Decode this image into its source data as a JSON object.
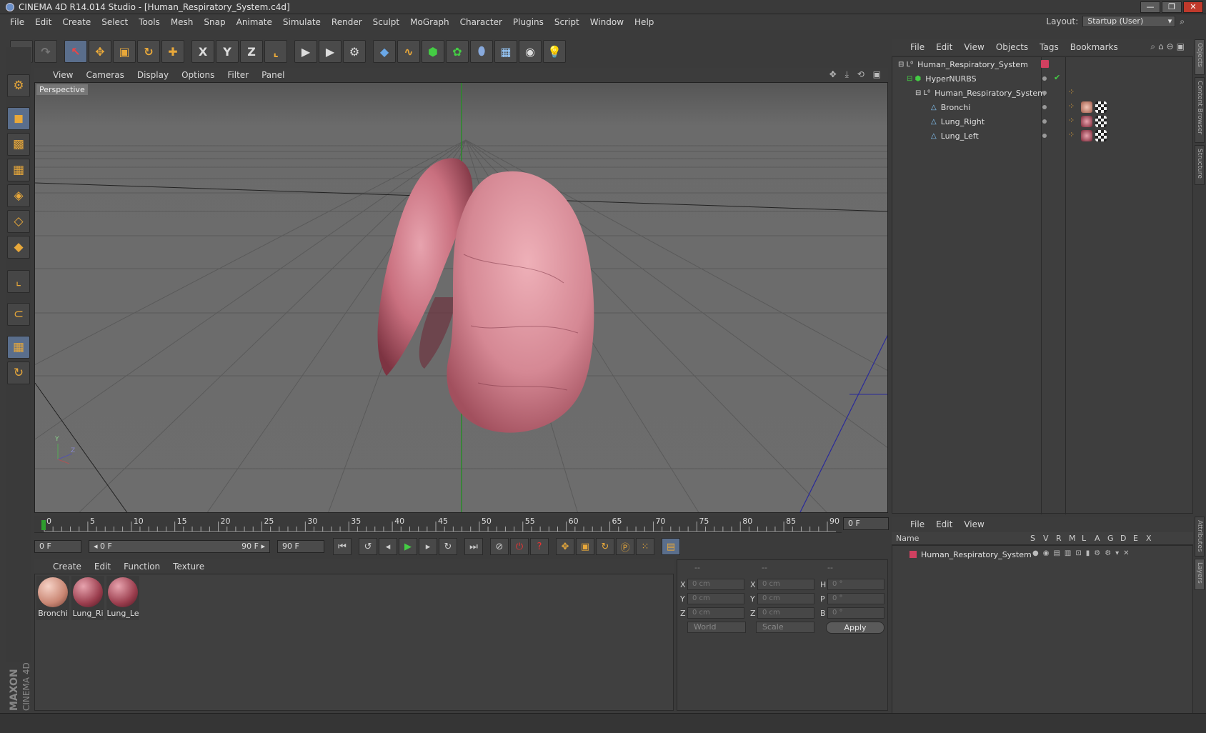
{
  "window": {
    "title": "CINEMA 4D R14.014 Studio - [Human_Respiratory_System.c4d]",
    "buttons": [
      "—",
      "❐",
      "✕"
    ]
  },
  "menubar": {
    "items": [
      "File",
      "Edit",
      "Create",
      "Select",
      "Tools",
      "Mesh",
      "Snap",
      "Animate",
      "Simulate",
      "Render",
      "Sculpt",
      "MoGraph",
      "Character",
      "Plugins",
      "Script",
      "Window",
      "Help"
    ],
    "layout_label": "Layout:",
    "layout_value": "Startup (User)"
  },
  "toolbar": {
    "axis_x": "X",
    "axis_y": "Y",
    "axis_z": "Z"
  },
  "viewport": {
    "menu": [
      "View",
      "Cameras",
      "Display",
      "Options",
      "Filter",
      "Panel"
    ],
    "label": "Perspective",
    "icons": "✥ ⤓ ⟲ ▣",
    "axis_y": "Y",
    "axis_z": "Z"
  },
  "timeline": {
    "ticks": [
      "0",
      "5",
      "10",
      "15",
      "20",
      "25",
      "30",
      "35",
      "40",
      "45",
      "50",
      "55",
      "60",
      "65",
      "70",
      "75",
      "80",
      "85",
      "90"
    ],
    "current_frame": "0 F"
  },
  "transport": {
    "start": "0 F",
    "range_start": "◂ 0 F",
    "range_end": "90 F ▸",
    "end": "90 F"
  },
  "materials": {
    "menu": [
      "Create",
      "Edit",
      "Function",
      "Texture"
    ],
    "items": [
      {
        "label": "Bronchi"
      },
      {
        "label": "Lung_Ri"
      },
      {
        "label": "Lung_Le"
      }
    ]
  },
  "coords": {
    "headers": [
      "--",
      "--",
      "--"
    ],
    "rows": [
      {
        "a": "X",
        "av": "0 cm",
        "b": "X",
        "bv": "0 cm",
        "c": "H",
        "cv": "0 °"
      },
      {
        "a": "Y",
        "av": "0 cm",
        "b": "Y",
        "bv": "0 cm",
        "c": "P",
        "cv": "0 °"
      },
      {
        "a": "Z",
        "av": "0 cm",
        "b": "Z",
        "bv": "0 cm",
        "c": "B",
        "cv": "0 °"
      }
    ],
    "mode": "World",
    "type": "Scale",
    "apply": "Apply"
  },
  "objects": {
    "menu": [
      "File",
      "Edit",
      "View",
      "Objects",
      "Tags",
      "Bookmarks"
    ],
    "tree": [
      {
        "name": "Human_Respiratory_System"
      },
      {
        "name": "HyperNURBS"
      },
      {
        "name": "Human_Respiratory_System"
      },
      {
        "name": "Bronchi"
      },
      {
        "name": "Lung_Right"
      },
      {
        "name": "Lung_Left"
      }
    ]
  },
  "layers": {
    "menu": [
      "File",
      "Edit",
      "View"
    ],
    "columns": [
      "Name",
      "S",
      "V",
      "R",
      "M",
      "L",
      "A",
      "G",
      "D",
      "E",
      "X"
    ],
    "items": [
      {
        "name": "Human_Respiratory_System"
      }
    ]
  },
  "sidetabs": [
    "Objects",
    "Content Browser",
    "Structure",
    "Attributes",
    "Layers"
  ],
  "brand": {
    "line1": "MAXON",
    "line2": "CINEMA 4D"
  }
}
